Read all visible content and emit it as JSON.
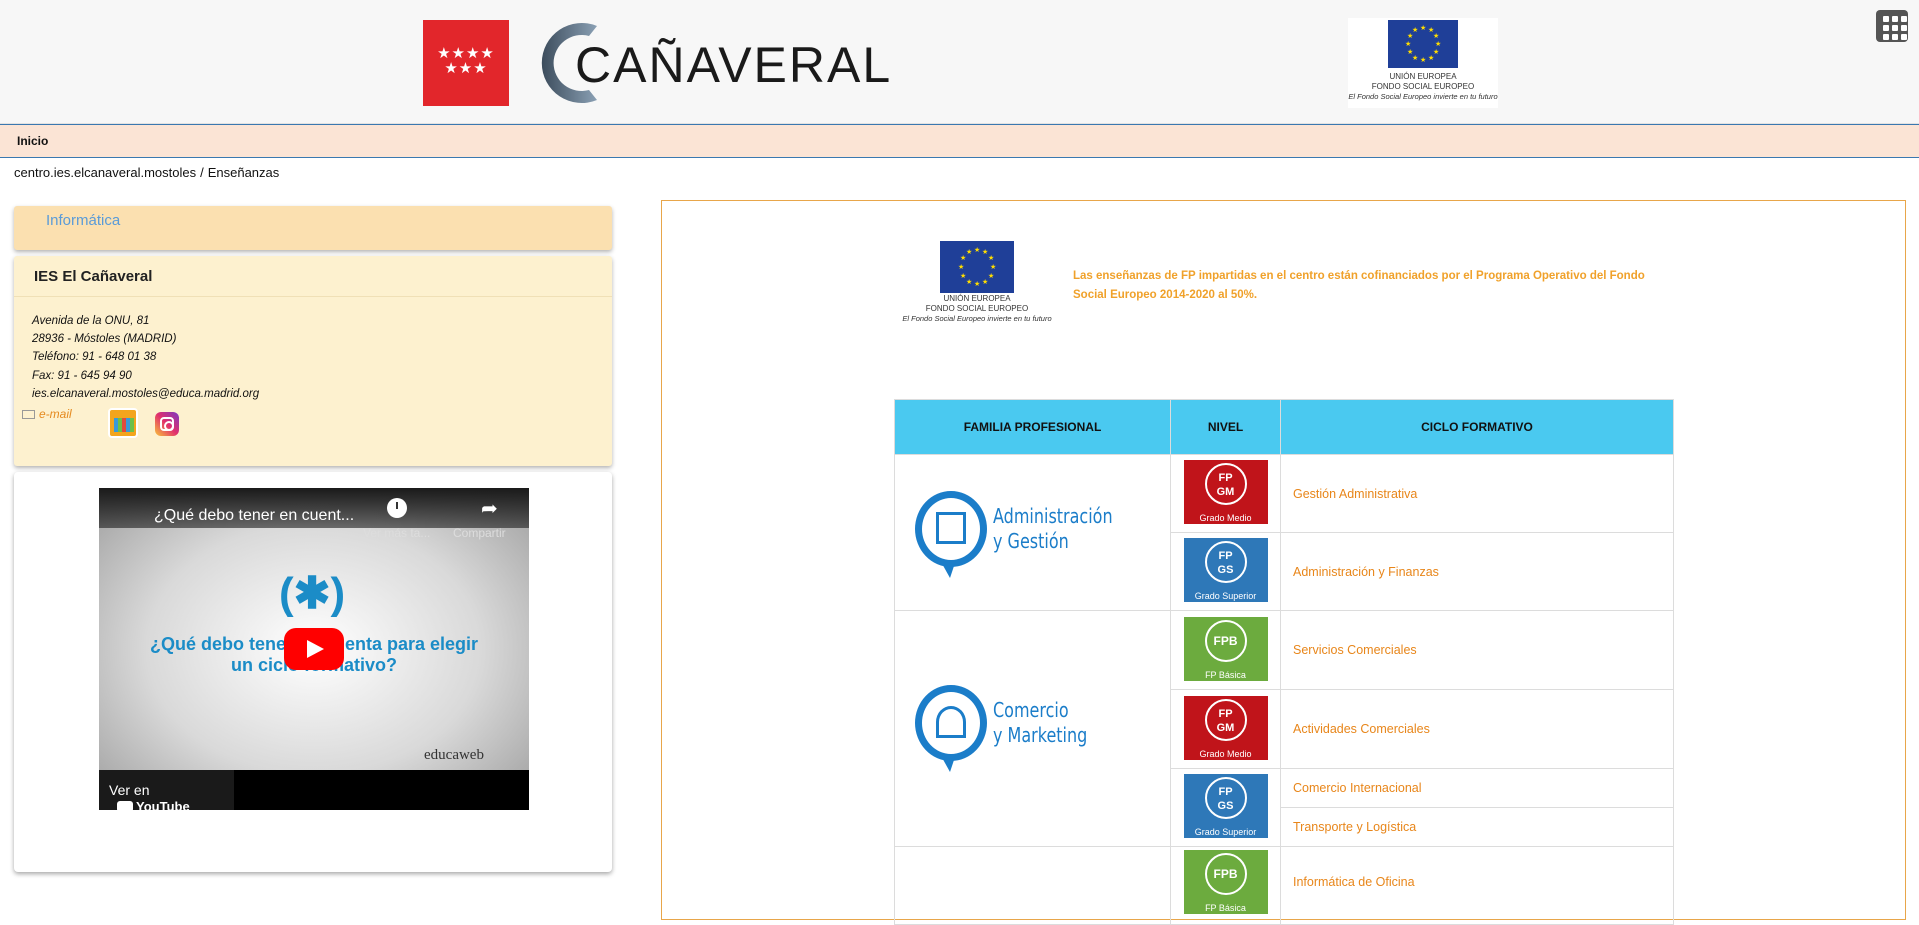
{
  "header": {
    "cam_logo_stars": "★★★★\n★★★",
    "brand_name": "CAÑAVERAL",
    "eu_logo": {
      "line1": "UNIÓN EUROPEA",
      "line2": "FONDO SOCIAL EUROPEO",
      "tagline": "El Fondo Social Europeo invierte en tu futuro"
    }
  },
  "nav": {
    "inicio": "Inicio"
  },
  "breadcrumb": {
    "site": "centro.ies.elcanaveral.mostoles",
    "separator": "/",
    "current": "Enseñanzas"
  },
  "sidebar": {
    "informatica": "Informática",
    "school": {
      "title": "IES El Cañaveral",
      "address": "Avenida de la ONU, 81",
      "city": "28936 - Móstoles (MADRID)",
      "phone": "Teléfono: 91 - 648 01 38",
      "fax": "Fax: 91 - 645 94 90",
      "email": "ies.elcanaveral.mostoles@educa.madrid.org",
      "email_link": "e-mail"
    },
    "video": {
      "title": "¿Qué debo tener en cuent...",
      "watch_later": "Ver más ta...",
      "share": "Compartir",
      "asterisk": "(✱)",
      "question": "¿Qué debo tener en cuenta para elegir un ciclo formativo?",
      "brand": "educaweb",
      "watch_on": "Ver en",
      "youtube": "YouTube"
    }
  },
  "main": {
    "eu_logo": {
      "line1": "UNIÓN EUROPEA",
      "line2": "FONDO SOCIAL EUROPEO",
      "tagline": "El Fondo Social Europeo invierte en tu futuro"
    },
    "fp_note": "Las enseñanzas de FP impartidas en el centro están cofinanciados por el Programa Operativo del Fondo Social Europeo 2014-2020 al 50%.",
    "table": {
      "headers": [
        "FAMILIA PROFESIONAL",
        "NIVEL",
        "CICLO FORMATIVO"
      ],
      "families": {
        "admin": {
          "line1": "Administración",
          "line2": "y Gestión"
        },
        "comercio": {
          "line1": "Comercio",
          "line2": "y Marketing"
        }
      },
      "levels": {
        "gm": {
          "top": "FP",
          "bottom": "GM",
          "caption": "Grado Medio"
        },
        "gs": {
          "top": "FP",
          "bottom": "GS",
          "caption": "Grado Superior"
        },
        "fpb": {
          "top": "FPB",
          "caption": "FP Básica"
        }
      },
      "cycles": {
        "c1": "Gestión Administrativa",
        "c2": "Administración y Finanzas",
        "c3": "Servicios Comerciales",
        "c4": "Actividades Comerciales",
        "c5": "Comercio Internacional",
        "c6": "Transporte y Logística",
        "c7": "Informática de Oficina"
      }
    }
  },
  "colors": {
    "nav_bg": "#fbe4d5",
    "table_header": "#4ac9f0",
    "link_orange": "#e8861a",
    "gm": "#c0141a",
    "gs": "#2e78b8",
    "fpb": "#6cab3e",
    "family_blue": "#1b7dc9"
  }
}
